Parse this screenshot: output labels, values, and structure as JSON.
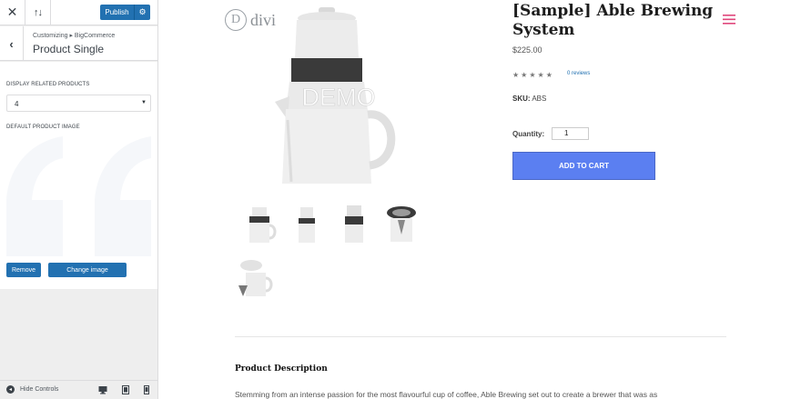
{
  "customizer": {
    "publish_label": "Publish",
    "breadcrumb": "Customizing ▸ BigCommerce",
    "section_title": "Product Single",
    "related_label": "DISPLAY RELATED PRODUCTS",
    "related_value": "4",
    "image_label": "DEFAULT PRODUCT IMAGE",
    "remove_label": "Remove",
    "change_label": "Change image",
    "hide_controls_label": "Hide Controls",
    "accent_color": "#2271b1",
    "icons": [
      "close-icon",
      "sort-icon",
      "gear-icon",
      "back-chevron-icon",
      "select-caret-icon",
      "desktop-icon",
      "tablet-icon",
      "mobile-icon"
    ]
  },
  "preview": {
    "logo_letter": "D",
    "logo_text": "divi",
    "watermark": "DEMO",
    "product_title": "[Sample] Able Brewing System",
    "price": "$225.00",
    "stars": "★★★★★",
    "reviews": "0 reviews",
    "sku_label": "SKU:",
    "sku_value": "ABS",
    "quantity_label": "Quantity:",
    "quantity_value": "1",
    "add_to_cart": "ADD TO CART",
    "description_title": "Product Description",
    "description_text": "Stemming from an intense passion for the most flavourful cup of coffee, Able Brewing set out to create a brewer that was as",
    "button_color": "#5b7ff1",
    "menu_color": "#e0457b"
  }
}
